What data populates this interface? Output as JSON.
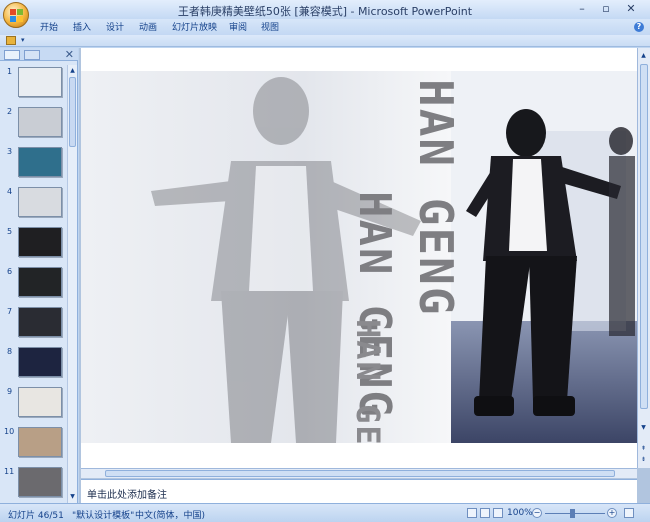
{
  "window": {
    "title": "王者韩庚精美壁纸50张 [兼容模式] - Microsoft PowerPoint",
    "minimize_icon": "minimize-icon",
    "restore_icon": "restore-icon",
    "close_icon": "close-icon"
  },
  "ribbon": {
    "tabs": [
      {
        "label": "开始"
      },
      {
        "label": "插入"
      },
      {
        "label": "设计"
      },
      {
        "label": "动画"
      },
      {
        "label": "幻灯片放映"
      },
      {
        "label": "审阅"
      },
      {
        "label": "视图"
      }
    ]
  },
  "thumbnails": [
    {
      "num": "1",
      "color": "#e9edf2"
    },
    {
      "num": "2",
      "color": "#c9cdd4"
    },
    {
      "num": "3",
      "color": "#2f6f8c"
    },
    {
      "num": "4",
      "color": "#d8dbe0"
    },
    {
      "num": "5",
      "color": "#1f1f22"
    },
    {
      "num": "6",
      "color": "#222426"
    },
    {
      "num": "7",
      "color": "#2a2c33"
    },
    {
      "num": "8",
      "color": "#1d2440"
    },
    {
      "num": "9",
      "color": "#e8e6e2"
    },
    {
      "num": "10",
      "color": "#b89f86"
    },
    {
      "num": "11",
      "color": "#6b6a6e"
    }
  ],
  "slide": {
    "text_1": "HAN GENG",
    "text_2": "HAN GENG",
    "text_3": "HAN GENG"
  },
  "notes": {
    "placeholder": "单击此处添加备注"
  },
  "status": {
    "slide_info": "幻灯片 46/51",
    "theme": "\"默认设计模板\"",
    "language": "中文(简体，中国)",
    "zoom": "100%"
  },
  "colors": {
    "accent": "#15428b",
    "ribbon_bg": "#c3d8f3"
  }
}
